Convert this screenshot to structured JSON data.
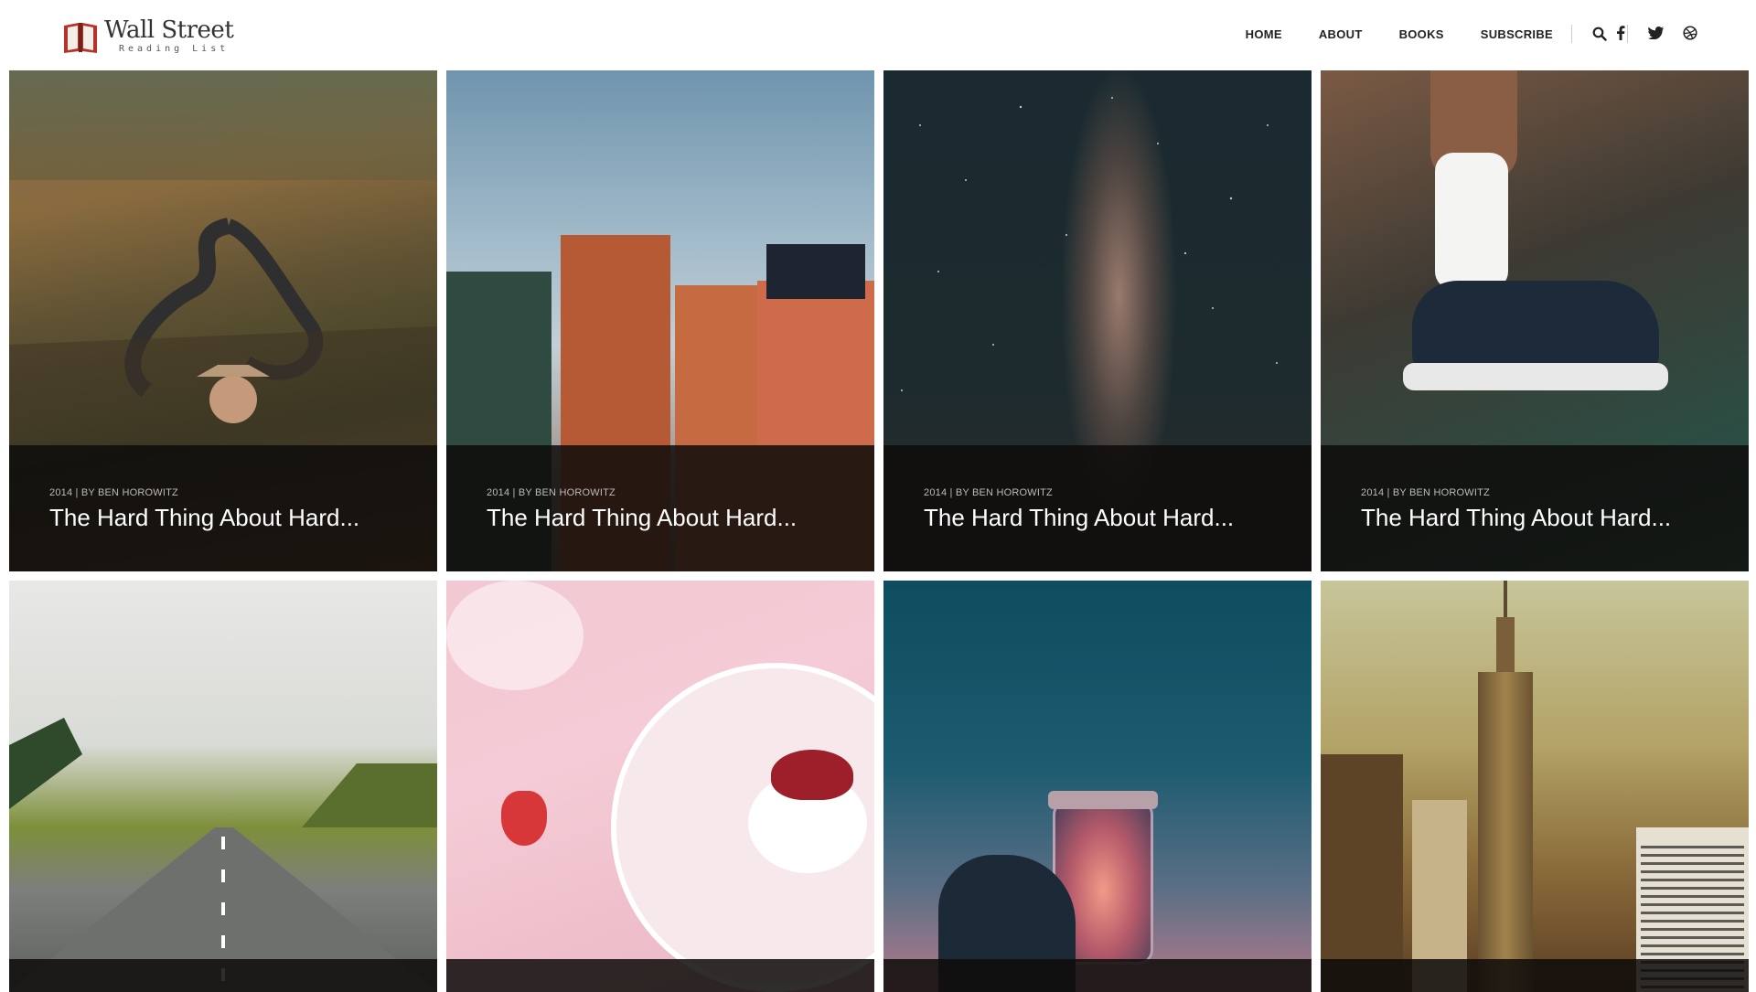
{
  "brand": {
    "title": "Wall Street",
    "subtitle": "Reading List"
  },
  "nav": {
    "items": [
      "HOME",
      "ABOUT",
      "BOOKS",
      "SUBSCRIBE"
    ]
  },
  "icons": {
    "search": "search-icon",
    "facebook": "facebook-icon",
    "twitter": "twitter-icon",
    "dribbble": "dribbble-icon"
  },
  "cards": [
    {
      "meta": "2014 | BY BEN HOROWITZ",
      "title": "The Hard Thing About Hard..."
    },
    {
      "meta": "2014 | BY BEN HOROWITZ",
      "title": "The Hard Thing About Hard..."
    },
    {
      "meta": "2014 | BY BEN HOROWITZ",
      "title": "The Hard Thing About Hard..."
    },
    {
      "meta": "2014 | BY BEN HOROWITZ",
      "title": "The Hard Thing About Hard..."
    }
  ],
  "colors": {
    "overlay": "#0e0c0a",
    "logo_red": "#c0392b"
  }
}
